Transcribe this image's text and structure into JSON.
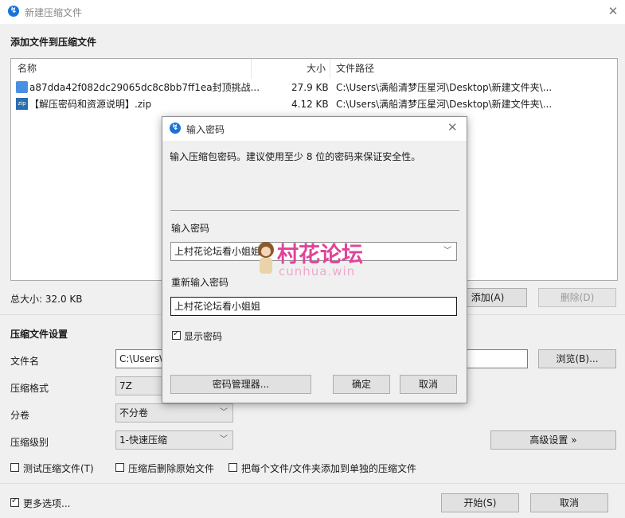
{
  "window": {
    "title": "新建压缩文件",
    "section_add": "添加文件到压缩文件"
  },
  "file_list": {
    "columns": [
      "名称",
      "大小",
      "文件路径"
    ],
    "rows": [
      {
        "name": "a87dda42f082dc29065dc8c8bb7ff1ea封顶挑战...",
        "size": "27.9 KB",
        "path": "C:\\Users\\满船清梦压星河\\Desktop\\新建文件夹\\..."
      },
      {
        "name": "【解压密码和资源说明】.zip",
        "size": "4.12 KB",
        "path": "C:\\Users\\满船清梦压星河\\Desktop\\新建文件夹\\..."
      }
    ]
  },
  "total_size": "总大小: 32.0 KB",
  "buttons": {
    "add": "添加(A)",
    "delete": "删除(D)",
    "browse": "浏览(B)...",
    "advanced": "高级设置 »",
    "start": "开始(S)",
    "cancel": "取消"
  },
  "settings": {
    "heading": "压缩文件设置",
    "filename_label": "文件名",
    "filename_value": "C:\\Users\\",
    "format_label": "压缩格式",
    "format_value": "7Z",
    "split_label": "分卷",
    "split_value": "不分卷",
    "level_label": "压缩级别",
    "level_value": "1-快速压缩"
  },
  "options": {
    "test": "测试压缩文件(T)",
    "delete_after": "压缩后删除原始文件",
    "separate": "把每个文件/文件夹添加到单独的压缩文件",
    "more": "更多选项..."
  },
  "dialog": {
    "title": "输入密码",
    "description": "输入压缩包密码。建议使用至少 8 位的密码来保证安全性。",
    "password_label": "输入密码",
    "password_value": "上村花论坛看小姐姐",
    "confirm_label": "重新输入密码",
    "confirm_value": "上村花论坛看小姐姐",
    "show_password": "显示密码",
    "manager": "密码管理器...",
    "ok": "确定",
    "cancel": "取消"
  },
  "watermark": {
    "text": "村花论坛",
    "sub": "cunhua.win"
  },
  "colors": {
    "accent": "#1a73d9",
    "watermark": "#e0449a"
  }
}
